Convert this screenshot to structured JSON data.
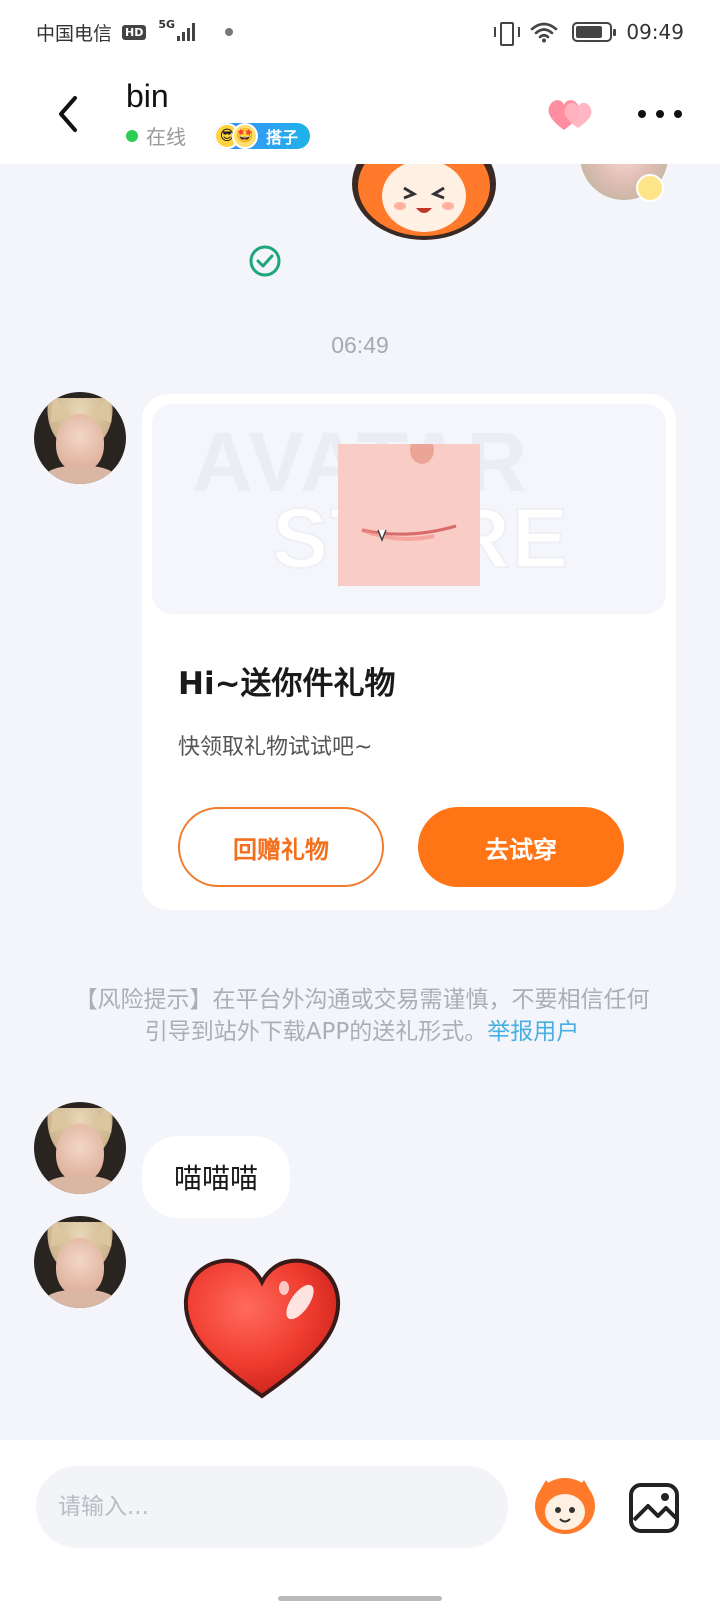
{
  "status_bar": {
    "carrier": "中国电信",
    "hd": "HD",
    "network": "5G",
    "time": "09:49"
  },
  "header": {
    "name": "bin",
    "status": "在线",
    "tag_label": "搭子",
    "icons": {
      "back": "chevron-left-icon",
      "heart": "double-heart-icon",
      "more": "more-dots-icon"
    }
  },
  "chat": {
    "timestamp": "06:49",
    "gift_card": {
      "watermark_line1": "AVATAR",
      "watermark_line2": "STORE",
      "title": "Hi~送你件礼物",
      "subtitle": "快领取礼物试试吧~",
      "btn_return": "回赠礼物",
      "btn_try": "去试穿"
    },
    "risk_notice": {
      "text": "【风险提示】在平台外沟通或交易需谨慎，不要相信任何引导到站外下载APP的送礼形式。",
      "link": "举报用户"
    },
    "text_message": "喵喵喵"
  },
  "input": {
    "placeholder": "请输入..."
  },
  "colors": {
    "accent_orange": "#ff7414",
    "link_blue": "#48aee3",
    "online_green": "#2ecc55",
    "background": "#f3f5fa"
  }
}
